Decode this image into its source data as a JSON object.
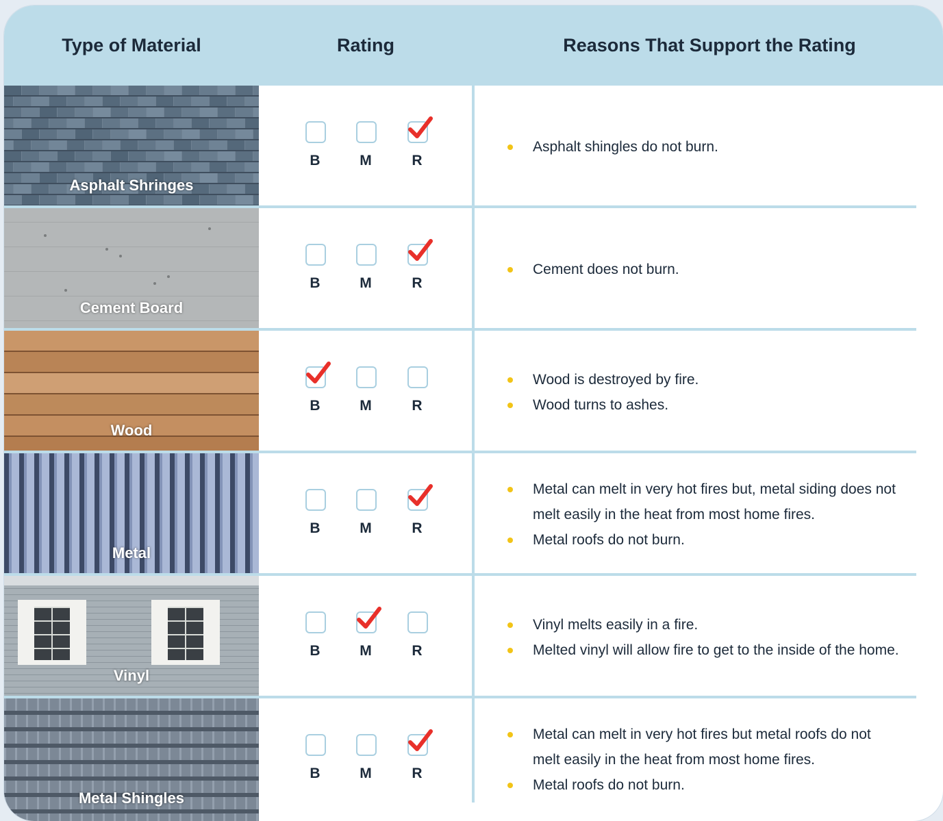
{
  "header": {
    "col_material": "Type of Material",
    "col_rating": "Rating",
    "col_reasons": "Reasons That Support the Rating"
  },
  "options": [
    "B",
    "M",
    "R"
  ],
  "colors": {
    "header_bg": "#bcdce9",
    "check": "#e8302a",
    "bullet": "#f2c417",
    "box_border": "#a9cfe0"
  },
  "rows": [
    {
      "material": "Asphalt Shringes",
      "image": "asphalt-shingles-photo",
      "checked": "R",
      "reasons": [
        "Asphalt shingles do not burn."
      ]
    },
    {
      "material": "Cement Board",
      "image": "cement-board-photo",
      "checked": "R",
      "reasons": [
        "Cement does not burn."
      ]
    },
    {
      "material": "Wood",
      "image": "wood-siding-photo",
      "checked": "B",
      "reasons": [
        "Wood is destroyed by fire.",
        "Wood turns to ashes."
      ]
    },
    {
      "material": "Metal",
      "image": "metal-siding-photo",
      "checked": "R",
      "reasons": [
        "Metal can melt in very hot fires but, metal siding does not melt easily in the heat from most home fires.",
        "Metal roofs do not burn."
      ]
    },
    {
      "material": "Vinyl",
      "image": "vinyl-siding-photo",
      "checked": "M",
      "reasons": [
        "Vinyl melts easily in a fire.",
        "Melted vinyl will allow fire to get to the inside of the home."
      ]
    },
    {
      "material": "Metal Shingles",
      "image": "metal-shingles-photo",
      "checked": "R",
      "reasons": [
        "Metal can melt in very hot fires but metal roofs do not melt easily in the heat from most home fires.",
        "Metal roofs do not burn."
      ]
    }
  ]
}
